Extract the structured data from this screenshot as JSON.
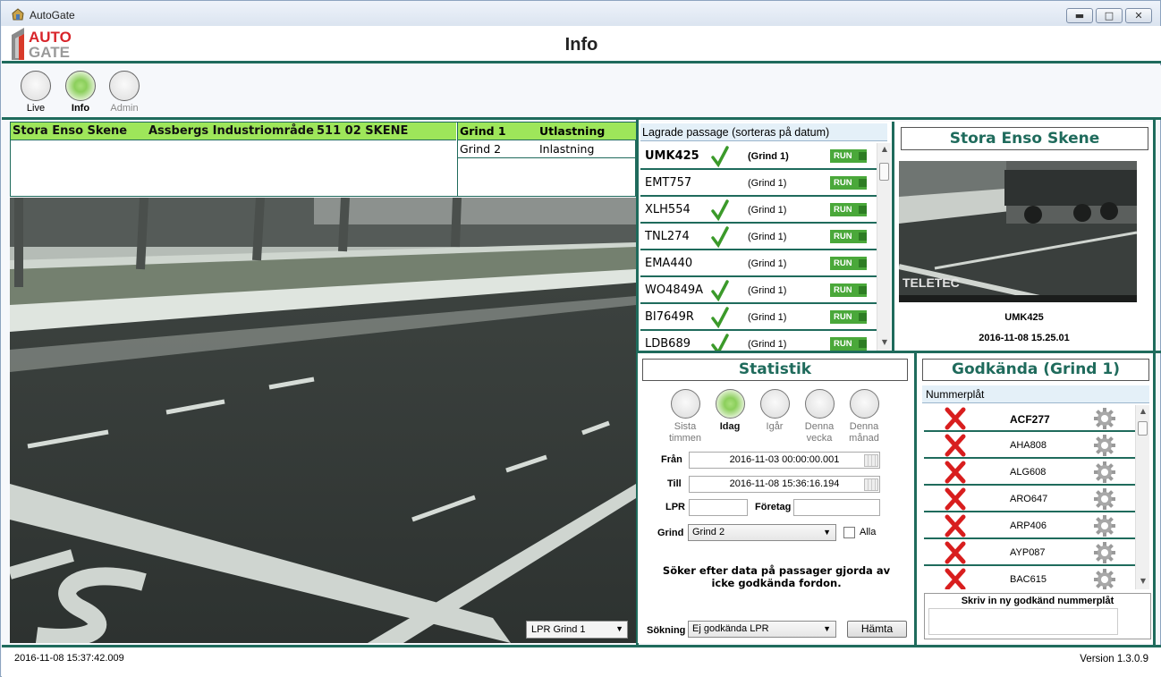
{
  "window": {
    "title": "AutoGate"
  },
  "header": {
    "logo_top": "AUTO",
    "logo_bottom": "GATE",
    "page_title": "Info"
  },
  "nav": [
    {
      "label": "Live",
      "active": false
    },
    {
      "label": "Info",
      "active": true
    },
    {
      "label": "Admin",
      "active": false
    }
  ],
  "site": {
    "name": "Stora Enso Skene",
    "area": "Assbergs Industriområde",
    "postal": "511 02  SKENE"
  },
  "gates": [
    {
      "name": "Grind 1",
      "type": "Utlastning",
      "selected": true
    },
    {
      "name": "Grind 2",
      "type": "Inlastning",
      "selected": false
    }
  ],
  "camera": {
    "select_value": "LPR Grind 1"
  },
  "passages": {
    "header": "Lagrade passage (sorteras på datum)",
    "run_label": "RUN",
    "rows": [
      {
        "plate": "UMK425",
        "approved": true,
        "gate": "(Grind 1)",
        "bold": true
      },
      {
        "plate": "EMT757",
        "approved": false,
        "gate": "(Grind 1)",
        "bold": false
      },
      {
        "plate": "XLH554",
        "approved": true,
        "gate": "(Grind 1)",
        "bold": false
      },
      {
        "plate": "TNL274",
        "approved": true,
        "gate": "(Grind 1)",
        "bold": false
      },
      {
        "plate": "EMA440",
        "approved": false,
        "gate": "(Grind 1)",
        "bold": false
      },
      {
        "plate": "WO4849A",
        "approved": true,
        "gate": "(Grind 1)",
        "bold": false
      },
      {
        "plate": "BI7649R",
        "approved": true,
        "gate": "(Grind 1)",
        "bold": false
      },
      {
        "plate": "LDB689",
        "approved": true,
        "gate": "(Grind 1)",
        "bold": false
      }
    ]
  },
  "snapshot": {
    "title": "Stora Enso Skene",
    "watermark": "TELETEC",
    "plate": "UMK425",
    "timestamp": "2016-11-08 15.25.01"
  },
  "stats": {
    "title": "Statistik",
    "periods": [
      {
        "label1": "Sista",
        "label2": "timmen",
        "active": false
      },
      {
        "label1": "Idag",
        "label2": "",
        "active": true
      },
      {
        "label1": "Igår",
        "label2": "",
        "active": false
      },
      {
        "label1": "Denna",
        "label2": "vecka",
        "active": false
      },
      {
        "label1": "Denna",
        "label2": "månad",
        "active": false
      }
    ],
    "from_label": "Från",
    "from_value": "2016-11-03 00:00:00.001",
    "to_label": "Till",
    "to_value": "2016-11-08 15:36:16.194",
    "lpr_label": "LPR",
    "lpr_value": "",
    "company_label": "Företag",
    "company_value": "",
    "gate_label": "Grind",
    "gate_value": "Grind 2",
    "all_label": "Alla",
    "note": "Söker efter data på passager gjorda av icke godkända fordon.",
    "search_label": "Sökning",
    "search_value": "Ej godkända LPR",
    "fetch_label": "Hämta"
  },
  "approved": {
    "title": "Godkända (Grind 1)",
    "column": "Nummerplåt",
    "rows": [
      {
        "plate": "ACF277",
        "bold": true
      },
      {
        "plate": "AHA808",
        "bold": false
      },
      {
        "plate": "ALG608",
        "bold": false
      },
      {
        "plate": "ARO647",
        "bold": false
      },
      {
        "plate": "ARP406",
        "bold": false
      },
      {
        "plate": "AYP087",
        "bold": false
      },
      {
        "plate": "BAC615",
        "bold": false
      }
    ],
    "new_label": "Skriv in ny godkänd nummerplåt"
  },
  "status": {
    "timestamp": "2016-11-08 15:37:42.009",
    "version": "Version 1.3.0.9"
  },
  "colors": {
    "accent": "#1f6b5c",
    "highlight": "#9ee65a",
    "run": "#4aa83a",
    "reject": "#d81e1e"
  }
}
